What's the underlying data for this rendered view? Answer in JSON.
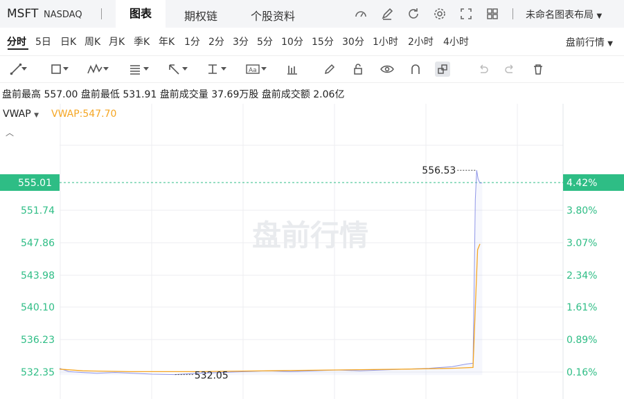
{
  "header": {
    "symbol": "MSFT",
    "exchange": "NASDAQ",
    "tabs": [
      "图表",
      "期权链",
      "个股资料"
    ],
    "layout_label": "未命名图表布局",
    "icons": [
      "gauge-icon",
      "edit-icon",
      "refresh-icon",
      "settings-icon",
      "fullscreen-icon",
      "grid-icon"
    ]
  },
  "periods": [
    "分时",
    "5日",
    "日K",
    "周K",
    "月K",
    "季K",
    "年K",
    "1分",
    "2分",
    "3分",
    "5分",
    "10分",
    "15分",
    "30分",
    "1小时",
    "2小时",
    "4小时"
  ],
  "active_period": "分时",
  "session_selector": "盘前行情",
  "toolbar_icons": [
    "trendline-icon",
    "rectangle-icon",
    "pattern-icon",
    "fibonacci-icon",
    "arrow-icon",
    "measure-icon",
    "text-icon",
    "bar-icon",
    "pencil-icon",
    "lock-icon",
    "eye-icon",
    "magnet-icon",
    "link-icon",
    "undo-icon",
    "redo-icon",
    "trash-icon"
  ],
  "stats": {
    "high_label": "盘前最高",
    "high_value": "557.00",
    "low_label": "盘前最低",
    "low_value": "531.91",
    "vol_label": "盘前成交量",
    "vol_value": "37.69万股",
    "amount_label": "盘前成交额",
    "amount_value": "2.06亿"
  },
  "indicator": {
    "name": "VWAP",
    "value_text": "VWAP:547.70"
  },
  "watermark": "盘前行情",
  "colors": {
    "price_line": "#8f96e8",
    "vwap_line": "#f5a623",
    "axis_text": "#2ebd85",
    "current_bg": "#2ebd85",
    "dashed": "#2ebd85"
  },
  "chart_data": {
    "type": "line",
    "y_ticks": [
      "551.74",
      "547.86",
      "543.98",
      "540.10",
      "536.23",
      "532.35"
    ],
    "pct_ticks": [
      "3.80%",
      "3.07%",
      "2.34%",
      "1.61%",
      "0.89%",
      "0.16%"
    ],
    "ylim": [
      531.5,
      558.5
    ],
    "current_price": "555.01",
    "current_pct": "4.42%",
    "high_marker": {
      "x": 0.903,
      "label": "556.53",
      "value": 556.53
    },
    "low_marker": {
      "x": 0.25,
      "label": "532.05",
      "value": 532.05
    },
    "series": [
      {
        "name": "price",
        "points": [
          [
            0,
            532.8
          ],
          [
            0.02,
            532.4
          ],
          [
            0.05,
            532.3
          ],
          [
            0.08,
            532.2
          ],
          [
            0.12,
            532.3
          ],
          [
            0.16,
            532.2
          ],
          [
            0.2,
            532.1
          ],
          [
            0.25,
            532.05
          ],
          [
            0.3,
            532.2
          ],
          [
            0.35,
            532.3
          ],
          [
            0.4,
            532.4
          ],
          [
            0.45,
            532.5
          ],
          [
            0.5,
            532.4
          ],
          [
            0.55,
            532.5
          ],
          [
            0.6,
            532.6
          ],
          [
            0.65,
            532.5
          ],
          [
            0.7,
            532.6
          ],
          [
            0.75,
            532.7
          ],
          [
            0.8,
            532.8
          ],
          [
            0.85,
            533.0
          ],
          [
            0.88,
            533.3
          ],
          [
            0.895,
            533.4
          ],
          [
            0.898,
            545.0
          ],
          [
            0.9,
            553.0
          ],
          [
            0.903,
            556.53
          ],
          [
            0.906,
            555.5
          ],
          [
            0.91,
            555.0
          ],
          [
            0.915,
            555.01
          ]
        ]
      },
      {
        "name": "VWAP",
        "points": [
          [
            0,
            532.7
          ],
          [
            0.05,
            532.5
          ],
          [
            0.15,
            532.4
          ],
          [
            0.3,
            532.4
          ],
          [
            0.45,
            532.5
          ],
          [
            0.6,
            532.6
          ],
          [
            0.75,
            532.7
          ],
          [
            0.85,
            532.8
          ],
          [
            0.895,
            532.9
          ],
          [
            0.9,
            540.0
          ],
          [
            0.905,
            547.0
          ],
          [
            0.91,
            547.7
          ]
        ]
      }
    ]
  }
}
